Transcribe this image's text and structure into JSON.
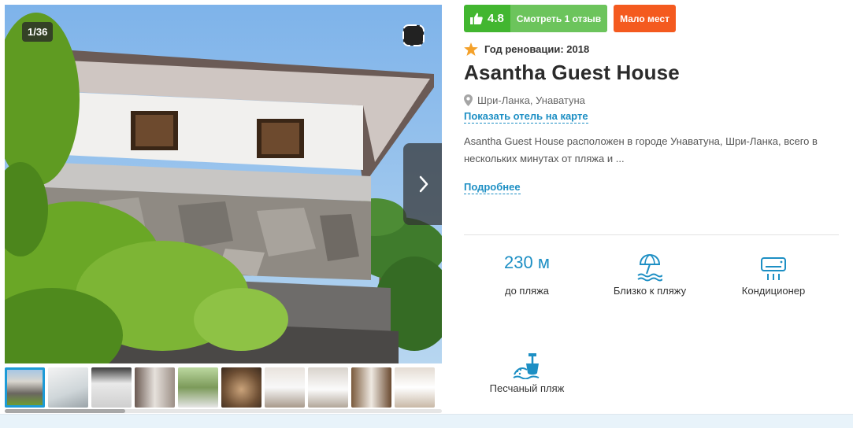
{
  "gallery": {
    "counter": "1/36",
    "thumb_count": 10,
    "next_label": "next-photo",
    "favorite_label": "favorite"
  },
  "rating": {
    "score": "4.8",
    "reviews_label": "Смотреть 1 отзыв"
  },
  "badge_few_places": "Мало мест",
  "renovation": "Год реновации: 2018",
  "hotel_name": "Asantha Guest House",
  "location": "Шри-Ланка, Унаватуна",
  "map_link": "Показать отель на карте",
  "description": "Asantha Guest House расположен в городе Унаватуна, Шри-Ланка, всего в нескольких минутах от пляжа и ...",
  "more_link": "Подробнее",
  "features": [
    {
      "value": "230 м",
      "label": "до пляжа"
    },
    {
      "icon": "beach-umbrella-icon",
      "label": "Близко к пляжу"
    },
    {
      "icon": "air-conditioner-icon",
      "label": "Кондиционер"
    },
    {
      "icon": "sand-beach-icon",
      "label": "Песчаный пляж"
    }
  ],
  "colors": {
    "rating_green": "#42b630",
    "few_orange": "#f45a1f",
    "link_blue": "#1d8fc4",
    "star_orange": "#f4a12a"
  }
}
